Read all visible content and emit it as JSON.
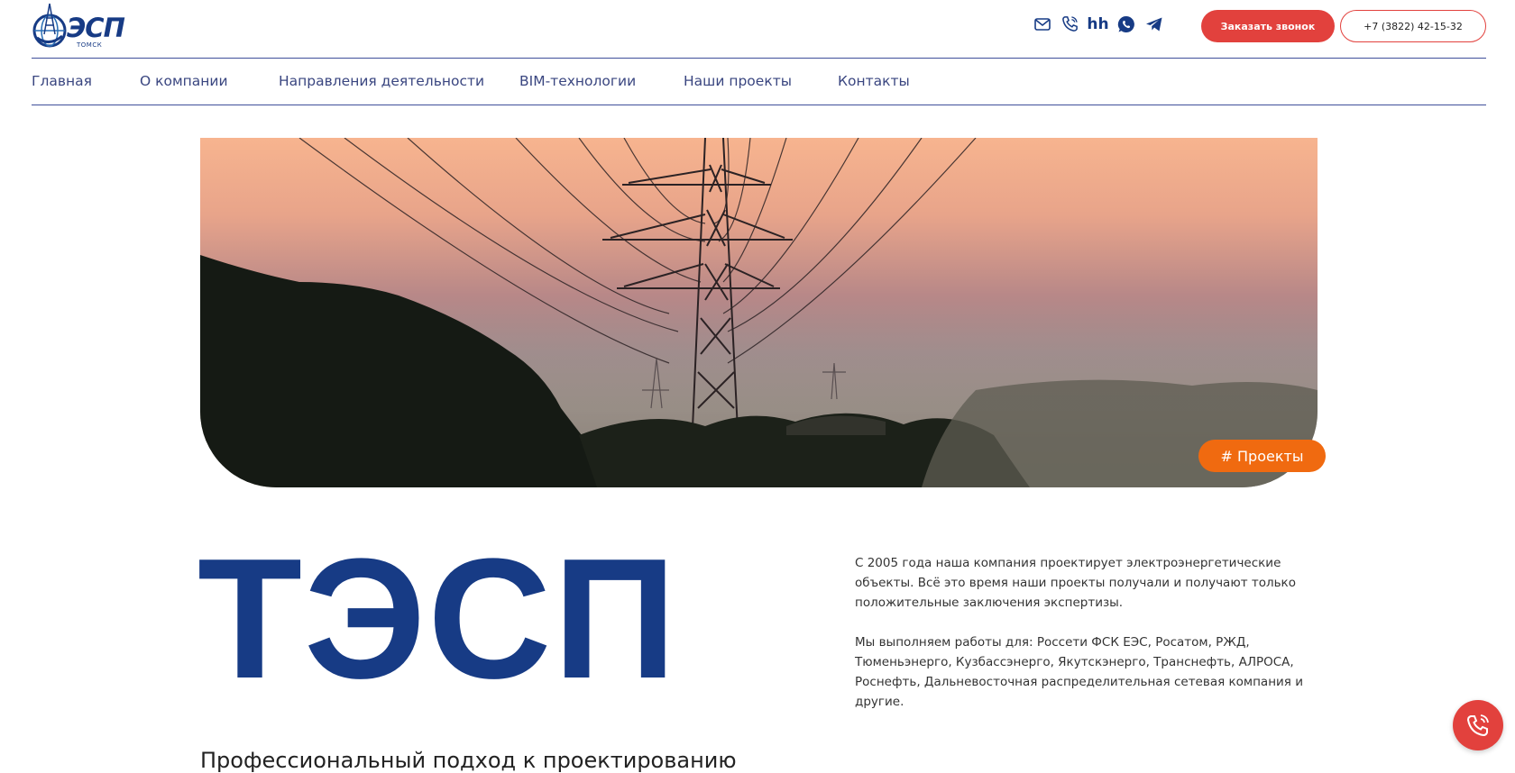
{
  "logo": {
    "text": "ЭСП",
    "subtext": "ТОМСК"
  },
  "header": {
    "icons": [
      "mail-icon",
      "phone-icon",
      "hh-icon",
      "whatsapp-icon",
      "telegram-icon"
    ],
    "hh_label": "hh",
    "callback_button": "Заказать звонок",
    "phone_button": "+7 (3822) 42-15-32"
  },
  "nav": {
    "items": [
      {
        "label": "Главная"
      },
      {
        "label": "О компании"
      },
      {
        "label": "Направления деятельности"
      },
      {
        "label": "BIM-технологии"
      },
      {
        "label": "Наши проекты"
      },
      {
        "label": "Контакты"
      }
    ]
  },
  "hero": {
    "tag": "# Проекты"
  },
  "main": {
    "title": "ТЭСП",
    "about": [
      "С 2005 года наша компания проектирует электроэнергетические объекты. Всё это время наши проекты получали и получают только положительные заключения экспертизы.",
      "Мы выполняем работы для: Россети ФСК ЕЭС, Росатом, РЖД, Тюменьэнерго, Кузбассэнерго, Якутскэнерго, Транснефть, АЛРОСА, Роснефть, Дальневосточная распределительная сетевая компания и другие."
    ],
    "subheading": "Профессиональный подход к проектированию"
  },
  "colors": {
    "brand_blue": "#173b85",
    "accent_red": "#e2413d",
    "tag_orange": "#f06a10"
  }
}
